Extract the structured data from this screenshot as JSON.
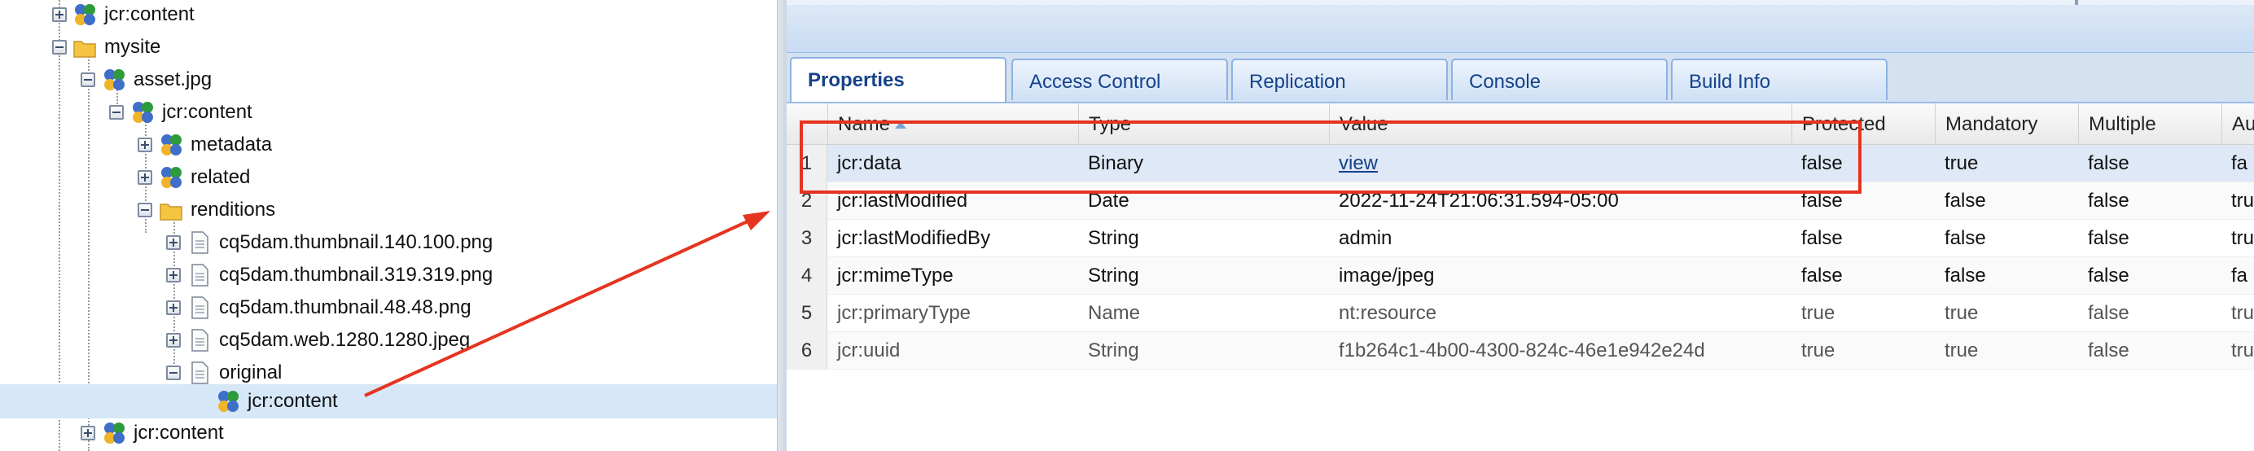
{
  "tree": {
    "nodes": [
      {
        "label": "jcr:content",
        "icon": "node-icon",
        "expander": "plus"
      },
      {
        "label": "mysite",
        "icon": "folder-icon",
        "expander": "minus"
      },
      {
        "label": "asset.jpg",
        "icon": "node-icon",
        "expander": "minus"
      },
      {
        "label": "jcr:content",
        "icon": "node-icon",
        "expander": "minus"
      },
      {
        "label": "metadata",
        "icon": "node-icon",
        "expander": "plus"
      },
      {
        "label": "related",
        "icon": "node-icon",
        "expander": "plus"
      },
      {
        "label": "renditions",
        "icon": "folder-icon",
        "expander": "minus"
      },
      {
        "label": "cq5dam.thumbnail.140.100.png",
        "icon": "file-icon",
        "expander": "plus"
      },
      {
        "label": "cq5dam.thumbnail.319.319.png",
        "icon": "file-icon",
        "expander": "plus"
      },
      {
        "label": "cq5dam.thumbnail.48.48.png",
        "icon": "file-icon",
        "expander": "plus"
      },
      {
        "label": "cq5dam.web.1280.1280.jpeg",
        "icon": "file-icon",
        "expander": "plus"
      },
      {
        "label": "original",
        "icon": "file-icon",
        "expander": "minus"
      },
      {
        "label": "jcr:content",
        "icon": "node-icon",
        "expander": "none",
        "selected": true
      },
      {
        "label": "jcr:content",
        "icon": "node-icon",
        "expander": "plus"
      }
    ]
  },
  "tabs": [
    {
      "label": "Properties",
      "active": true
    },
    {
      "label": "Access Control",
      "active": false
    },
    {
      "label": "Replication",
      "active": false
    },
    {
      "label": "Console",
      "active": false
    },
    {
      "label": "Build Info",
      "active": false
    }
  ],
  "grid": {
    "columns": [
      "Name",
      "Type",
      "Value",
      "Protected",
      "Mandatory",
      "Multiple",
      "Au"
    ],
    "sorted_column": "Name",
    "rows": [
      {
        "num": "1",
        "name": "jcr:data",
        "type": "Binary",
        "value": "view",
        "protected": "false",
        "mandatory": "true",
        "multiple": "false",
        "auto": "fa"
      },
      {
        "num": "2",
        "name": "jcr:lastModified",
        "type": "Date",
        "value": "2022-11-24T21:06:31.594-05:00",
        "protected": "false",
        "mandatory": "false",
        "multiple": "false",
        "auto": "tru"
      },
      {
        "num": "3",
        "name": "jcr:lastModifiedBy",
        "type": "String",
        "value": "admin",
        "protected": "false",
        "mandatory": "false",
        "multiple": "false",
        "auto": "tru"
      },
      {
        "num": "4",
        "name": "jcr:mimeType",
        "type": "String",
        "value": "image/jpeg",
        "protected": "false",
        "mandatory": "false",
        "multiple": "false",
        "auto": "fa"
      },
      {
        "num": "5",
        "name": "jcr:primaryType",
        "type": "Name",
        "value": "nt:resource",
        "protected": "true",
        "mandatory": "true",
        "multiple": "false",
        "auto": "tru"
      },
      {
        "num": "6",
        "name": "jcr:uuid",
        "type": "String",
        "value": "f1b264c1-4b00-4300-824c-46e1e942e24d",
        "protected": "true",
        "mandatory": "true",
        "multiple": "false",
        "auto": "tru"
      }
    ]
  },
  "colors": {
    "annotation": "#e53420",
    "tab_text": "#15428b",
    "selection": "#d6e8f8"
  }
}
